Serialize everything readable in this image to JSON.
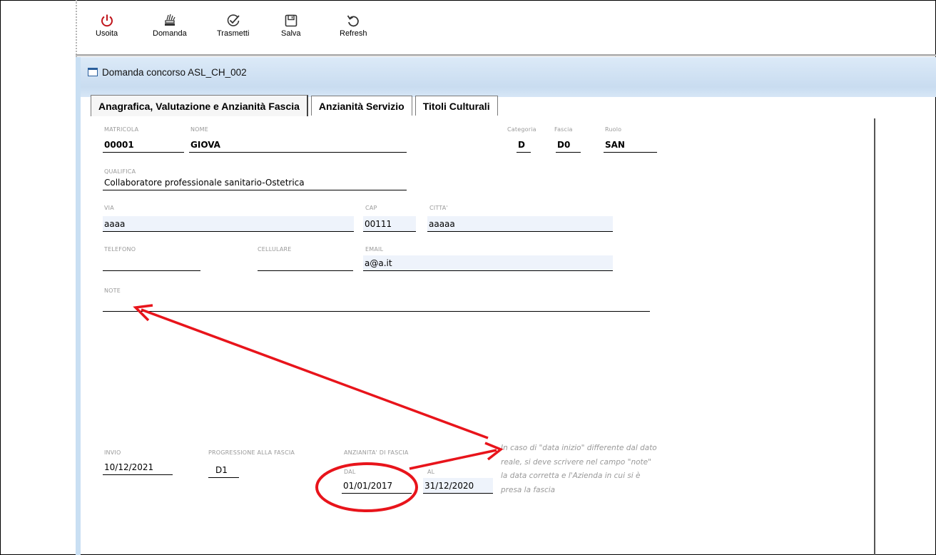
{
  "toolbar": {
    "buttons": [
      {
        "label": "Usoita",
        "icon": "power-icon"
      },
      {
        "label": "Domanda",
        "icon": "stack-icon"
      },
      {
        "label": "Trasmetti",
        "icon": "check-icon"
      },
      {
        "label": "Salva",
        "icon": "save-icon"
      },
      {
        "label": "Refresh",
        "icon": "refresh-icon"
      }
    ]
  },
  "window": {
    "title": "Domanda concorso ASL_CH_002"
  },
  "tabs": [
    {
      "label": "Anagrafica, Valutazione e Anzianità Fascia",
      "active": true
    },
    {
      "label": "Anzianità Servizio",
      "active": false
    },
    {
      "label": "Titoli Culturali",
      "active": false
    }
  ],
  "form": {
    "matricola": {
      "label": "MATRICOLA",
      "value": "00001"
    },
    "nome": {
      "label": "NOME",
      "value": "GIOVA"
    },
    "categoria": {
      "label": "Categoria",
      "value": "D"
    },
    "fascia": {
      "label": "Fascia",
      "value": "D0"
    },
    "ruolo": {
      "label": "Ruolo",
      "value": "SAN"
    },
    "qualifica": {
      "label": "QUALIFICA",
      "value": "Collaboratore professionale sanitario-Ostetrica"
    },
    "via": {
      "label": "VIA",
      "value": "aaaa"
    },
    "cap": {
      "label": "CAP",
      "value": "00111"
    },
    "citta": {
      "label": "CITTA'",
      "value": "aaaaa"
    },
    "telefono": {
      "label": "TELEFONO",
      "value": ""
    },
    "cellulare": {
      "label": "CELLULARE",
      "value": ""
    },
    "email": {
      "label": "EMAIL",
      "value": "a@a.it"
    },
    "note": {
      "label": "NOTE",
      "value": ""
    },
    "invio": {
      "label": "INVIO",
      "value": "10/12/2021"
    },
    "progressione": {
      "label": "PROGRESSIONE ALLA FASCIA",
      "value": "D1"
    },
    "anzianita": {
      "label": "ANZIANITA' DI FASCIA"
    },
    "dal": {
      "label": "DAL",
      "value": "01/01/2017"
    },
    "al": {
      "label": "AL",
      "value": "31/12/2020"
    }
  },
  "annotation": {
    "note_text": "In caso di \"data inizio\" differente dal dato reale, si deve scrivere nel campo \"note\" la data corretta e l'Azienda in cui si è presa la fascia",
    "color": "#e8141b"
  }
}
